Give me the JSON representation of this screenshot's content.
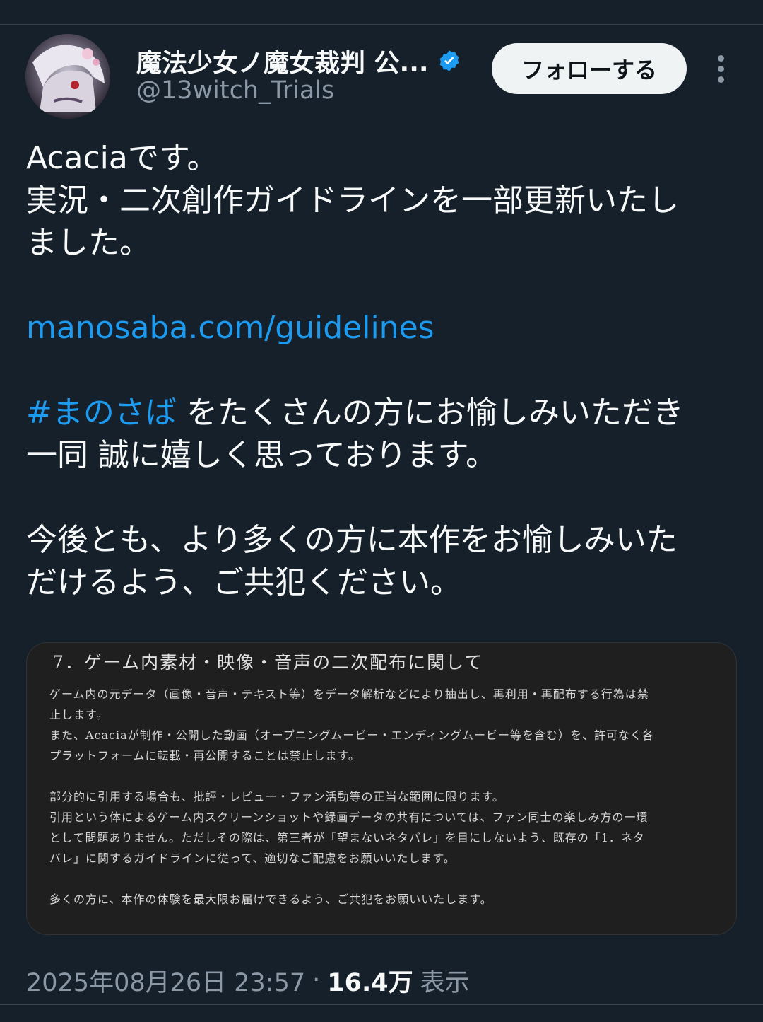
{
  "author": {
    "display_name": "魔法少女ノ魔女裁判 公...",
    "handle": "@13witch_Trials",
    "verified": true
  },
  "follow_label": "フォローする",
  "tweet": {
    "line1": "Acaciaです。",
    "line2": "実況・二次創作ガイドラインを一部更新いたし",
    "line3": "ました。",
    "link": "manosaba.com/guidelines",
    "hashtag": "#まのさば",
    "line4_rest": " をたくさんの方にお愉しみいただき",
    "line5": "一同 誠に嬉しく思っております。",
    "line6": "今後とも、より多くの方に本作をお愉しみいた",
    "line7": "だけるよう、ご共犯ください。"
  },
  "media": {
    "heading": "7．ゲーム内素材・映像・音声の二次配布に関して",
    "lines": [
      "ゲーム内の元データ（画像・音声・テキスト等）をデータ解析などにより抽出し、再利用・再配布する行為は禁",
      "止します。",
      "また、Acaciaが制作・公開した動画（オープニングムービー・エンディングムービー等を含む）を、許可なく各",
      "プラットフォームに転載・再公開することは禁止します。",
      "",
      "部分的に引用する場合も、批評・レビュー・ファン活動等の正当な範囲に限ります。",
      "引用という体によるゲーム内スクリーンショットや録画データの共有については、ファン同士の楽しみ方の一環",
      "として問題ありません。ただしその際は、第三者が「望まないネタバレ」を目にしないよう、既存の「1．ネタ",
      "バレ」に関するガイドラインに従って、適切なご配慮をお願いいたします。",
      "",
      "多くの方に、本作の体験を最大限お届けできるよう、ご共犯をお願いいたします。"
    ]
  },
  "meta": {
    "timestamp": "2025年08月26日 23:57",
    "separator": "·",
    "views": "16.4万",
    "views_label": "表示"
  },
  "colors": {
    "background": "#15202b",
    "link": "#1d9bf0",
    "muted": "#8b98a5",
    "verified": "#1d9bf0"
  }
}
